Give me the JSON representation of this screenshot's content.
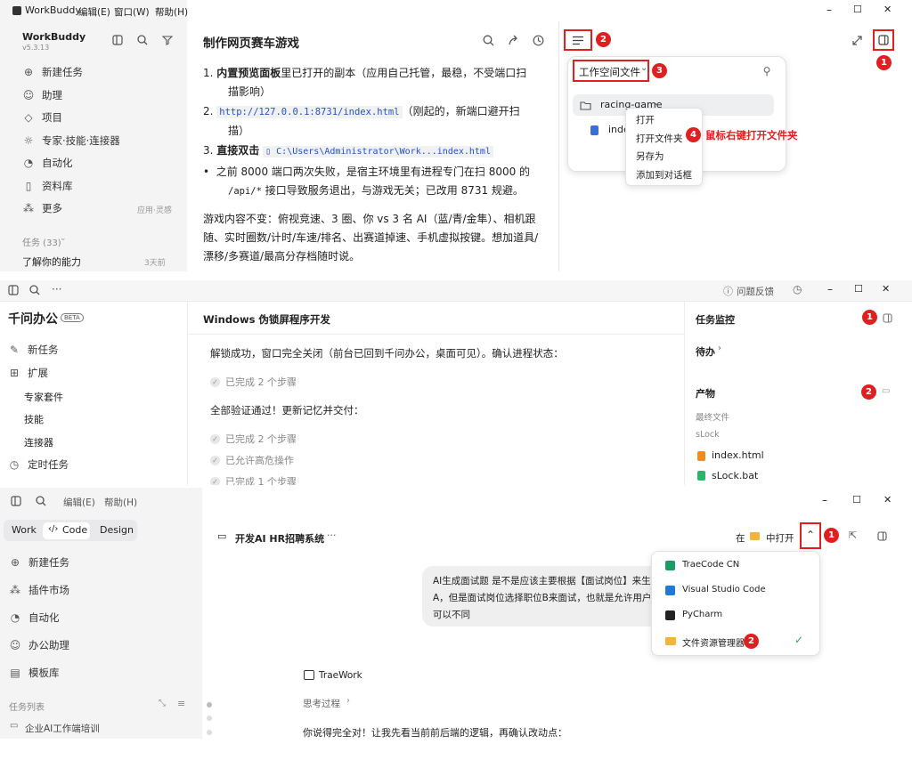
{
  "p1": {
    "app": {
      "name": "WorkBuddy",
      "version": "v5.3.13"
    },
    "menubar": [
      "编辑(E)",
      "窗口(W)",
      "帮助(H)"
    ],
    "win": {
      "min": "–",
      "max": "☐",
      "close": "✕"
    },
    "nav": [
      {
        "label": "新建任务",
        "icon": "⊕"
      },
      {
        "label": "助理",
        "icon": "☺"
      },
      {
        "label": "项目",
        "icon": "◇"
      },
      {
        "label": "专家·技能·连接器",
        "icon": "☼"
      },
      {
        "label": "自动化",
        "icon": "◔"
      },
      {
        "label": "资料库",
        "icon": "▯"
      },
      {
        "label": "更多",
        "icon": "⁂",
        "extra": "应用·灵感"
      }
    ],
    "tasks": {
      "header": "任务 (33)",
      "item": "了解你的能力",
      "item_time": "3天前"
    },
    "doc": {
      "title": "制作网页赛车游戏",
      "li1_bold": "内置预览面板",
      "li1_rest": "里已打开的副本（应用自己托管，最稳，不受端口扫",
      "li1_cont": "描影响）",
      "li2_code": "http://127.0.0.1:8731/index.html",
      "li2_rest": "（刚起的，新端口避开扫",
      "li2_cont": "描）",
      "li3_bold": "直接双击",
      "li3_code": "C:\\Users\\Administrator\\Work...index.html",
      "bullet_line1": "之前 8000 端口两次失败，是宿主环境里有进程专门在扫 8000 的",
      "bullet_code": "/api/*",
      "bullet_line2": " 接口导致服务退出，与游戏无关；已改用 8731 规避。",
      "para_line1": "游戏内容不变：俯视竞速、3 圈、你 vs 3 名 AI（蓝/青/金隼）、相机跟",
      "para_line2": "随、实时圈数/计时/车速/排名、出赛道掉速、手机虚拟按键。想加道具/",
      "para_line3": "漂移/多赛道/最高分存档随时说。"
    },
    "ws": {
      "label": "工作空间文件",
      "folder": "racing-game",
      "file": "inde"
    },
    "ctx": [
      "打开",
      "打开文件夹",
      "另存为",
      "添加到对话框"
    ],
    "annot": "鼠标右键打开文件夹",
    "badges": [
      "1",
      "2",
      "3",
      "4"
    ]
  },
  "p2": {
    "header": {
      "feedback": "问题反馈"
    },
    "app": {
      "title": "千问办公",
      "beta": "BETA"
    },
    "nav": {
      "new": "新任务",
      "extend": "扩展",
      "sub": [
        "专家套件",
        "技能",
        "连接器"
      ],
      "timed": "定时任务"
    },
    "chat": {
      "title": "Windows 伪锁屏程序开发",
      "msg1": "解锁成功，窗口完全关闭（前台已回到千问办公，桌面可见）。确认进程状态：",
      "step1": "已完成 2 个步骤",
      "msg2": "全部验证通过！更新记忆并交付：",
      "step2": "已完成 2 个步骤",
      "step3": "已允许高危操作",
      "step4": "已完成 1 个步骤"
    },
    "right": {
      "monitor": "任务监控",
      "pending": "待办",
      "artifacts": "产物",
      "final": "最终文件",
      "folder": "sLock",
      "files": [
        "index.html",
        "sLock.bat"
      ]
    },
    "badges": [
      "1",
      "2"
    ]
  },
  "p3": {
    "menubar": [
      "编辑(E)",
      "帮助(H)"
    ],
    "tabs": [
      "Work",
      "Code",
      "Design"
    ],
    "nav": [
      {
        "label": "新建任务",
        "icon": "⊕"
      },
      {
        "label": "插件市场",
        "icon": "⁂"
      },
      {
        "label": "自动化",
        "icon": "◔"
      },
      {
        "label": "办公助理",
        "icon": "☺"
      },
      {
        "label": "模板库",
        "icon": "▤"
      }
    ],
    "tasklist": {
      "header": "任务列表",
      "item": "企业AI工作端培训"
    },
    "chat": {
      "title": "开发AI HR招聘系统",
      "more": "···",
      "open_prefix": "在",
      "open_label": "中打开"
    },
    "bubble": {
      "line1": "AI生成面试题 是不是应该主要根据【面试岗位】来生",
      "line2": "A，但是面试岗位选择职位B来面试，也就是允许用户",
      "line3": "可以不同"
    },
    "dropdown": [
      "TraeCode CN",
      "Visual Studio Code",
      "PyCharm",
      "文件资源管理器"
    ],
    "reply": {
      "name": "TraeWork",
      "thinking": "思考过程",
      "text": "你说得完全对！让我先看当前前后端的逻辑，再确认改动点："
    },
    "badges": [
      "1",
      "2"
    ]
  }
}
